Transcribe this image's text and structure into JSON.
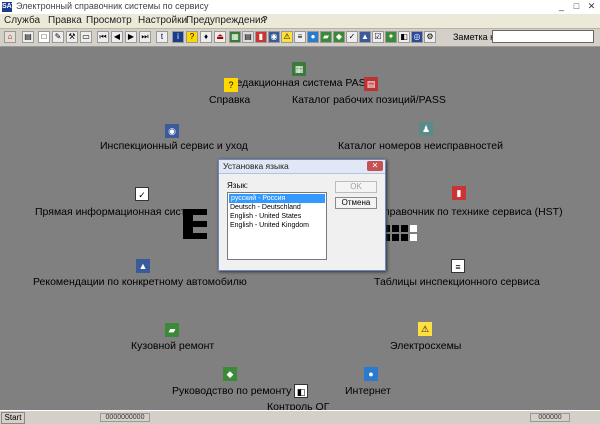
{
  "window": {
    "title": "Электронный справочник системы по сервису",
    "app_icon": "SAT",
    "controls": [
      "_",
      "□",
      "✕"
    ]
  },
  "menu": [
    "Служба",
    "Правка",
    "Просмотр",
    "Настройки",
    "Предупреждения",
    "?"
  ],
  "toolbar": {
    "order_label": "Заметка к заказу:",
    "order_value": ""
  },
  "items": {
    "pass": "Редакционная система PASS",
    "help": "Справка",
    "catalog": "Каталог рабочих позиций/PASS",
    "inspection": "Инспекционный сервис и уход",
    "faults": "Каталог  номеров  неисправностей",
    "direct": "Прямая информационная систем",
    "hst": "правочник по технике сервиса (HST)",
    "recommend": "Рекомендации по конкретному автомобилю",
    "tables": "Таблицы инспекционного сервиса",
    "body": "Кузовной ремонт",
    "elec": "Электросхемы",
    "repair": "Руководство по ремонту",
    "internet": "Интернет",
    "og": "Контроль ОГ"
  },
  "dialog": {
    "title": "Установка языка",
    "label": "Язык:",
    "languages": [
      "русский - Россия",
      "Deutsch - Deutschland",
      "English - United States",
      "English - United Kingdom"
    ],
    "selected_index": 0,
    "ok": "OK",
    "cancel": "Отмена"
  },
  "taskbar": {
    "start": "Start",
    "status_1": "0000000000",
    "status_2": "000000"
  },
  "colors": {
    "work_bg": "#808080",
    "selection": "#3399ff",
    "toolbar_bg": "#d4d0c8"
  }
}
